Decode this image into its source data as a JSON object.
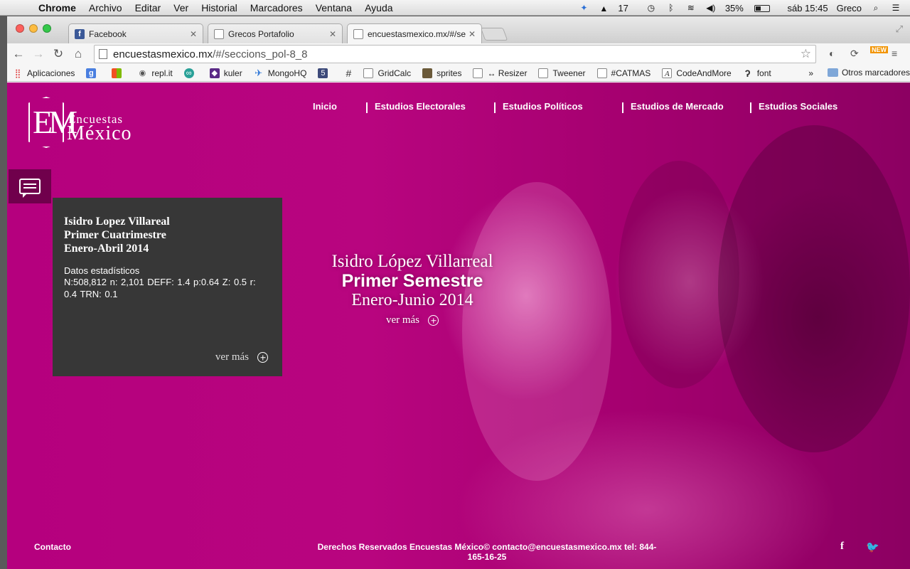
{
  "menubar": {
    "app_name": "Chrome",
    "items": [
      "Archivo",
      "Editar",
      "Ver",
      "Historial",
      "Marcadores",
      "Ventana",
      "Ayuda"
    ],
    "status": {
      "adobe_count": "17",
      "battery": "35%",
      "datetime": "sáb 15:45",
      "user": "Greco"
    }
  },
  "browser": {
    "tabs": [
      {
        "label": "Facebook",
        "color": "#3b5998"
      },
      {
        "label": "Grecos Portafolio",
        "color": "#ffffff"
      },
      {
        "label": "encuestasmexico.mx/#/se",
        "color": "#ffffff"
      }
    ],
    "url": {
      "domain": "encuestasmexico.mx",
      "path": "/#/seccions_pol-8_8"
    },
    "bookmarks": [
      {
        "label": "Aplicaciones",
        "icon": "apps-grid-icon"
      },
      {
        "label": "",
        "icon": "google-icon"
      },
      {
        "label": "",
        "icon": "windows-icon"
      },
      {
        "label": "repl.it",
        "icon": "replit-icon"
      },
      {
        "label": "",
        "icon": "infinity-icon"
      },
      {
        "label": "kuler",
        "icon": "kuler-icon"
      },
      {
        "label": "MongoHQ",
        "icon": "mongohq-icon"
      },
      {
        "label": "",
        "icon": "html5-icon"
      },
      {
        "label": "GridCalc",
        "icon": "grid-icon"
      },
      {
        "label": "sprites",
        "icon": "sprites-icon"
      },
      {
        "label": "↔ Resizer",
        "icon": "page-icon"
      },
      {
        "label": "Tweener",
        "icon": "page-icon"
      },
      {
        "label": "#CATMAS",
        "icon": "page-icon"
      },
      {
        "label": "CodeAndMore",
        "icon": "page-icon"
      },
      {
        "label": "font",
        "icon": "font-icon"
      }
    ],
    "bookmarks_more": "»",
    "other_bookmarks": "Otros marcadores"
  },
  "site": {
    "logo": {
      "line1": "Encuestas",
      "line2": "México",
      "mark": "EM"
    },
    "nav": [
      "Inicio",
      "Estudios Electorales",
      "Estudios Políticos",
      "Estudios de Mercado",
      "Estudios Sociales"
    ],
    "card": {
      "title_line1": "Isidro Lopez Villareal",
      "title_line2": "Primer Cuatrimestre",
      "title_line3": "Enero-Abril 2014",
      "stats_label": "Datos estadísticos",
      "stats": "N:508,812 n: 2,101 DEFF: 1.4 p:0.64 Z: 0.5 r: 0.4 TRN: 0.1",
      "more": "ver más"
    },
    "hero": {
      "name": "Isidro López Villarreal",
      "period": "Primer Semestre",
      "dates": "Enero-Junio 2014",
      "more": "ver más"
    },
    "footer": {
      "contact": "Contacto",
      "rights": "Derechos Reservados Encuestas México© contacto@encuestasmexico.mx tel: 844-165-16-25",
      "facebook": "f",
      "twitter": "🐦"
    },
    "colors": {
      "accent": "#b5007e",
      "card_bg": "#373737"
    }
  }
}
